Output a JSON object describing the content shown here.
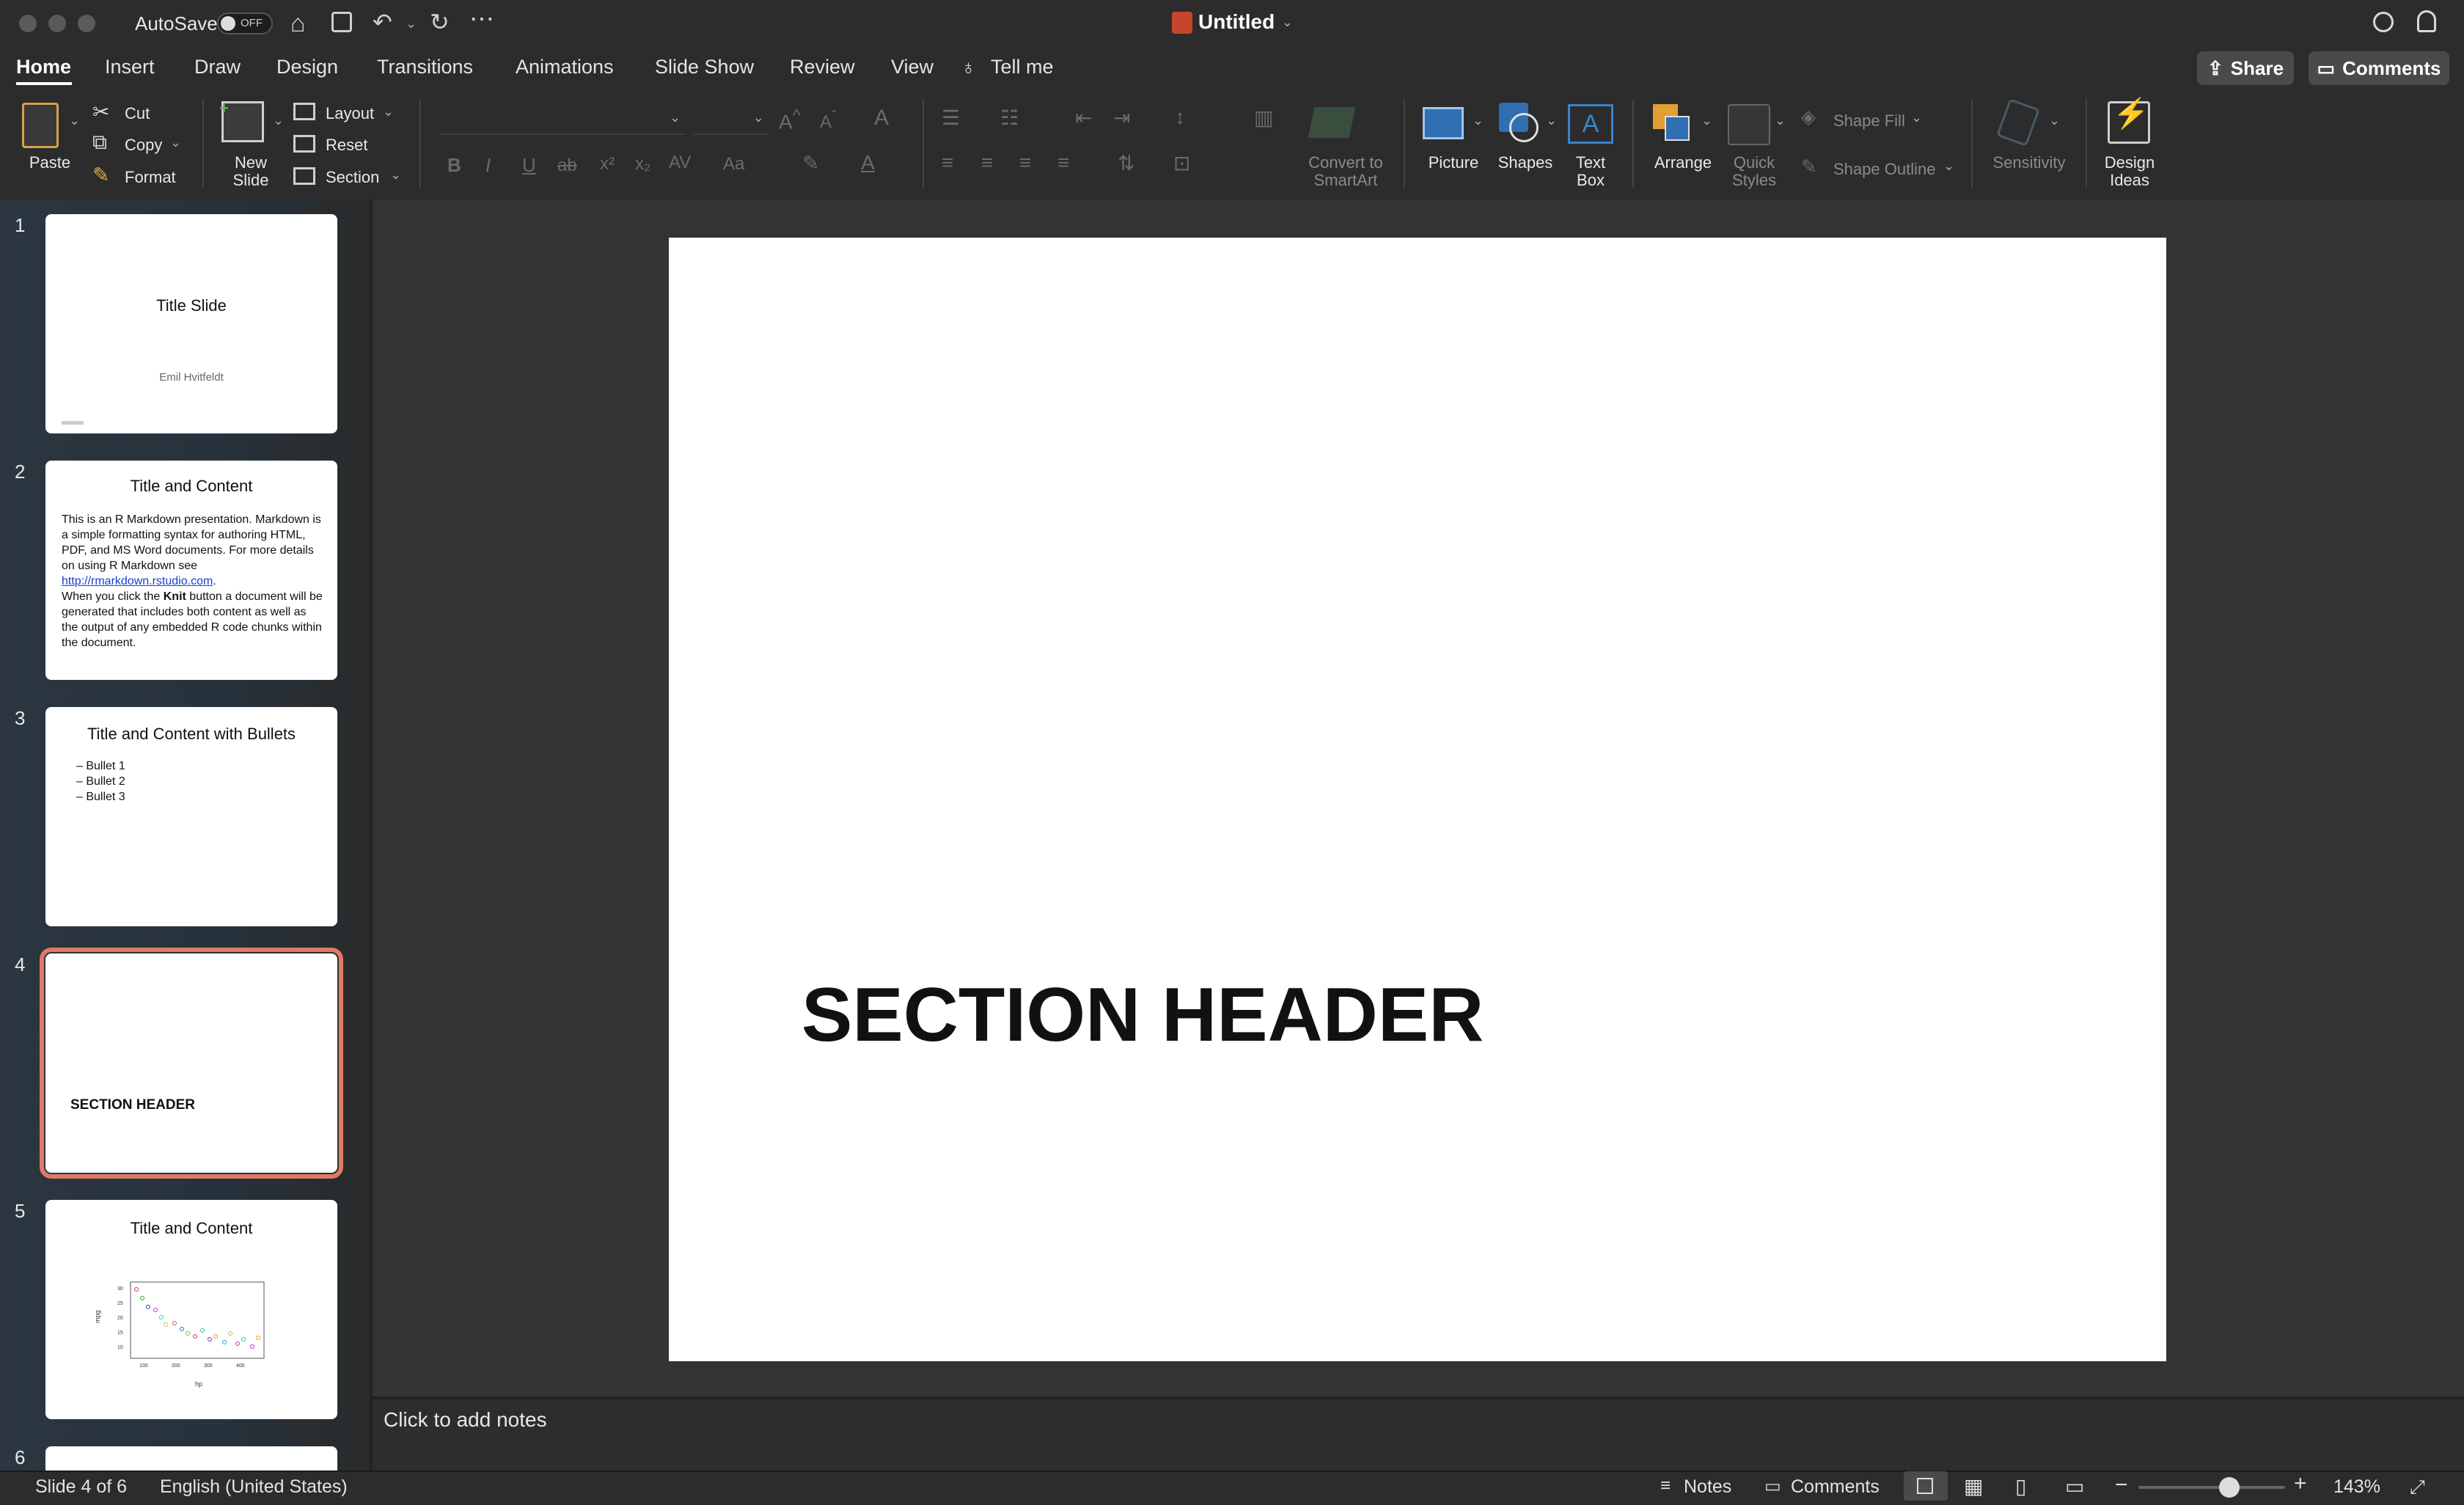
{
  "titlebar": {
    "autosave_label": "AutoSave",
    "autosave_state": "OFF",
    "doc_title": "Untitled"
  },
  "tabs": [
    "Home",
    "Insert",
    "Draw",
    "Design",
    "Transitions",
    "Animations",
    "Slide Show",
    "Review",
    "View"
  ],
  "tell_me": "Tell me",
  "share_label": "Share",
  "comments_label": "Comments",
  "ribbon": {
    "paste": "Paste",
    "cut": "Cut",
    "copy": "Copy",
    "format": "Format",
    "new_slide_1": "New",
    "new_slide_2": "Slide",
    "layout": "Layout",
    "reset": "Reset",
    "section": "Section",
    "convert_1": "Convert to",
    "convert_2": "SmartArt",
    "picture": "Picture",
    "shapes": "Shapes",
    "textbox_1": "Text",
    "textbox_2": "Box",
    "arrange": "Arrange",
    "quick_styles_1": "Quick",
    "quick_styles_2": "Styles",
    "shape_fill": "Shape Fill",
    "shape_outline": "Shape Outline",
    "sensitivity": "Sensitivity",
    "design_ideas_1": "Design",
    "design_ideas_2": "Ideas"
  },
  "slides": {
    "n1": "1",
    "n2": "2",
    "n3": "3",
    "n4": "4",
    "n5": "5",
    "n6": "6",
    "s1_title": "Title Slide",
    "s1_author": "Emil Hvitfeldt",
    "s2_title": "Title and Content",
    "s2_p1_a": "This is an R Markdown presentation. Markdown is a simple formatting syntax for authoring HTML, PDF, and MS Word documents. For more details on using R Markdown see ",
    "s2_link": "http://rmarkdown.rstudio.com",
    "s2_p1_b": ".",
    "s2_p2_a": "When you click the ",
    "s2_p2_knit": "Knit",
    "s2_p2_b": " button a document will be generated that includes both content as well as the output of any embedded R code chunks within the document.",
    "s3_title": "Title and Content with Bullets",
    "s3_b1": "– Bullet 1",
    "s3_b2": "– Bullet 2",
    "s3_b3": "– Bullet 3",
    "s4_header": "SECTION HEADER",
    "s5_title": "Title and Content",
    "s5_ylabel": "mpg",
    "s5_xlabel": "hp",
    "s5_yticks": [
      "10",
      "15",
      "20",
      "25",
      "30"
    ],
    "s5_xticks": [
      "100",
      "200",
      "300",
      "400"
    ]
  },
  "main_slide": {
    "header": "SECTION HEADER"
  },
  "notes_placeholder": "Click to add notes",
  "status": {
    "slide_info": "Slide 4 of 6",
    "language": "English (United States)",
    "notes": "Notes",
    "comments": "Comments",
    "zoom": "143%",
    "zoom_level": 0.62
  }
}
